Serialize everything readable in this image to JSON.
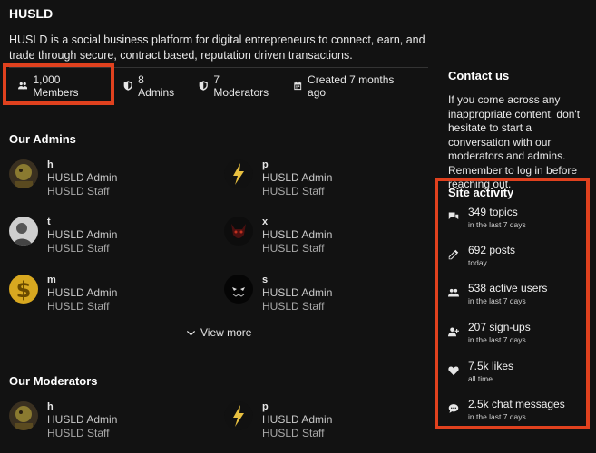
{
  "community": {
    "title": "HUSLD",
    "description": "HUSLD is a social business platform for digital entrepreneurs to connect, earn, and trade through secure, contract based, reputation driven transactions."
  },
  "stats": {
    "members": "1,000 Members",
    "admins": "8 Admins",
    "moderators": "7 Moderators",
    "created": "Created 7 months ago"
  },
  "admins_section": {
    "title": "Our Admins",
    "people": [
      {
        "name": "h",
        "role": "HUSLD Admin",
        "group": "HUSLD Staff"
      },
      {
        "name": "p",
        "role": "HUSLD Admin",
        "group": "HUSLD Staff"
      },
      {
        "name": "t",
        "role": "HUSLD Admin",
        "group": "HUSLD Staff"
      },
      {
        "name": "x",
        "role": "HUSLD Admin",
        "group": "HUSLD Staff"
      },
      {
        "name": "m",
        "role": "HUSLD Admin",
        "group": "HUSLD Staff"
      },
      {
        "name": "s",
        "role": "HUSLD Admin",
        "group": "HUSLD Staff"
      }
    ],
    "view_more": "View more"
  },
  "moderators_section": {
    "title": "Our Moderators",
    "people": [
      {
        "name": "h",
        "role": "HUSLD Admin",
        "group": "HUSLD Staff"
      },
      {
        "name": "p",
        "role": "HUSLD Admin",
        "group": "HUSLD Staff"
      }
    ]
  },
  "contact": {
    "title": "Contact us",
    "text": "If you come across any inappropriate content, don't hesitate to start a conversation with our moderators and admins. Remember to log in before reaching out."
  },
  "activity": {
    "title": "Site activity",
    "items": [
      {
        "icon": "topics-icon",
        "value": "349 topics",
        "period": "in the last 7 days"
      },
      {
        "icon": "pencil-icon",
        "value": "692 posts",
        "period": "today"
      },
      {
        "icon": "users-icon",
        "value": "538 active users",
        "period": "in the last 7 days"
      },
      {
        "icon": "user-plus-icon",
        "value": "207 sign-ups",
        "period": "in the last 7 days"
      },
      {
        "icon": "heart-icon",
        "value": "7.5k likes",
        "period": "all time"
      },
      {
        "icon": "chat-icon",
        "value": "2.5k chat messages",
        "period": "in the last 7 days"
      }
    ]
  },
  "colors": {
    "background": "#121212",
    "highlight": "#e0411e"
  }
}
